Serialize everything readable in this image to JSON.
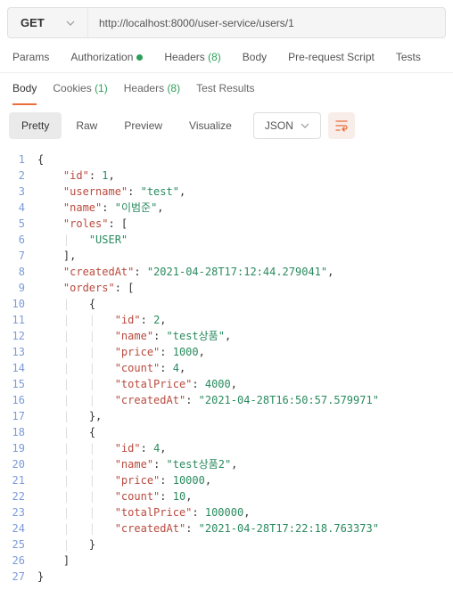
{
  "request": {
    "method": "GET",
    "url": "http://localhost:8000/user-service/users/1"
  },
  "requestTabs": {
    "params": "Params",
    "authorization": "Authorization",
    "headers": "Headers",
    "headersCount": "(8)",
    "body": "Body",
    "preRequest": "Pre-request Script",
    "tests": "Tests"
  },
  "responseTabs": {
    "body": "Body",
    "cookies": "Cookies",
    "cookiesCount": "(1)",
    "headers": "Headers",
    "headersCount": "(8)",
    "testResults": "Test Results"
  },
  "viewBar": {
    "pretty": "Pretty",
    "raw": "Raw",
    "preview": "Preview",
    "visualize": "Visualize",
    "format": "JSON"
  },
  "code": {
    "lines": [
      "1",
      "2",
      "3",
      "4",
      "5",
      "6",
      "7",
      "8",
      "9",
      "10",
      "11",
      "12",
      "13",
      "14",
      "15",
      "16",
      "17",
      "18",
      "19",
      "20",
      "21",
      "22",
      "23",
      "24",
      "25",
      "26",
      "27"
    ],
    "l1_open": "{",
    "l2_key": "\"id\"",
    "l2_val": "1",
    "l3_key": "\"username\"",
    "l3_val": "\"test\"",
    "l4_key": "\"name\"",
    "l4_val": "\"이범준\"",
    "l5_key": "\"roles\"",
    "l6_val": "\"USER\"",
    "l8_key": "\"createdAt\"",
    "l8_val": "\"2021-04-28T17:12:44.279041\"",
    "l9_key": "\"orders\"",
    "l11_key": "\"id\"",
    "l11_val": "2",
    "l12_key": "\"name\"",
    "l12_val": "\"test상품\"",
    "l13_key": "\"price\"",
    "l13_val": "1000",
    "l14_key": "\"count\"",
    "l14_val": "4",
    "l15_key": "\"totalPrice\"",
    "l15_val": "4000",
    "l16_key": "\"createdAt\"",
    "l16_val": "\"2021-04-28T16:50:57.579971\"",
    "l19_key": "\"id\"",
    "l19_val": "4",
    "l20_key": "\"name\"",
    "l20_val": "\"test상품2\"",
    "l21_key": "\"price\"",
    "l21_val": "10000",
    "l22_key": "\"count\"",
    "l22_val": "10",
    "l23_key": "\"totalPrice\"",
    "l23_val": "100000",
    "l24_key": "\"createdAt\"",
    "l24_val": "\"2021-04-28T17:22:18.763373\""
  }
}
